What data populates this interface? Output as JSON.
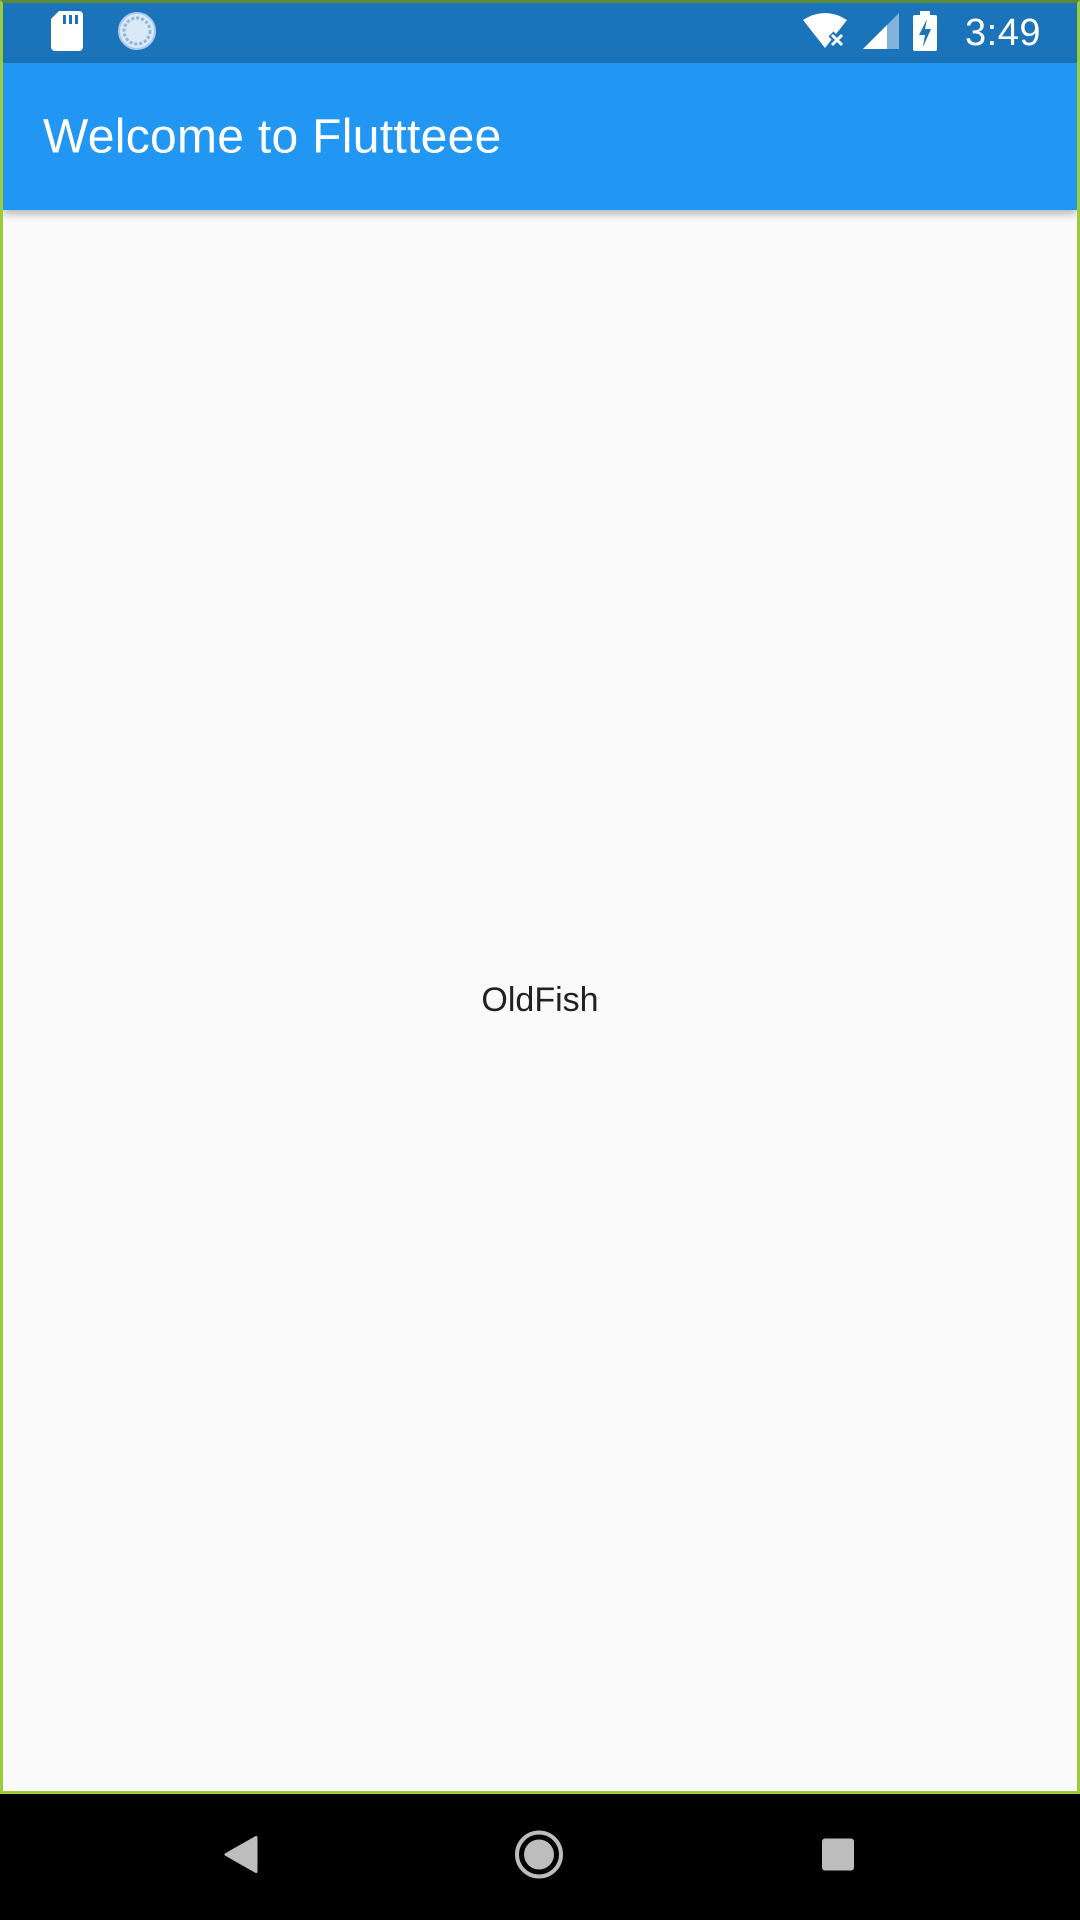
{
  "status_bar": {
    "time": "3:49",
    "icons": [
      "sd-card-icon",
      "sync-icon",
      "wifi-off-icon",
      "cell-signal-icon",
      "battery-charging-icon"
    ]
  },
  "app_bar": {
    "title": "Welcome to Fluttteee"
  },
  "body": {
    "text": "OldFish"
  },
  "nav_bar": {
    "buttons": [
      "back-icon",
      "home-icon",
      "recents-icon"
    ]
  },
  "colors": {
    "status_bar": "#1b74ba",
    "app_bar": "#2196f3",
    "background": "#fafafa",
    "text": "#212121"
  }
}
